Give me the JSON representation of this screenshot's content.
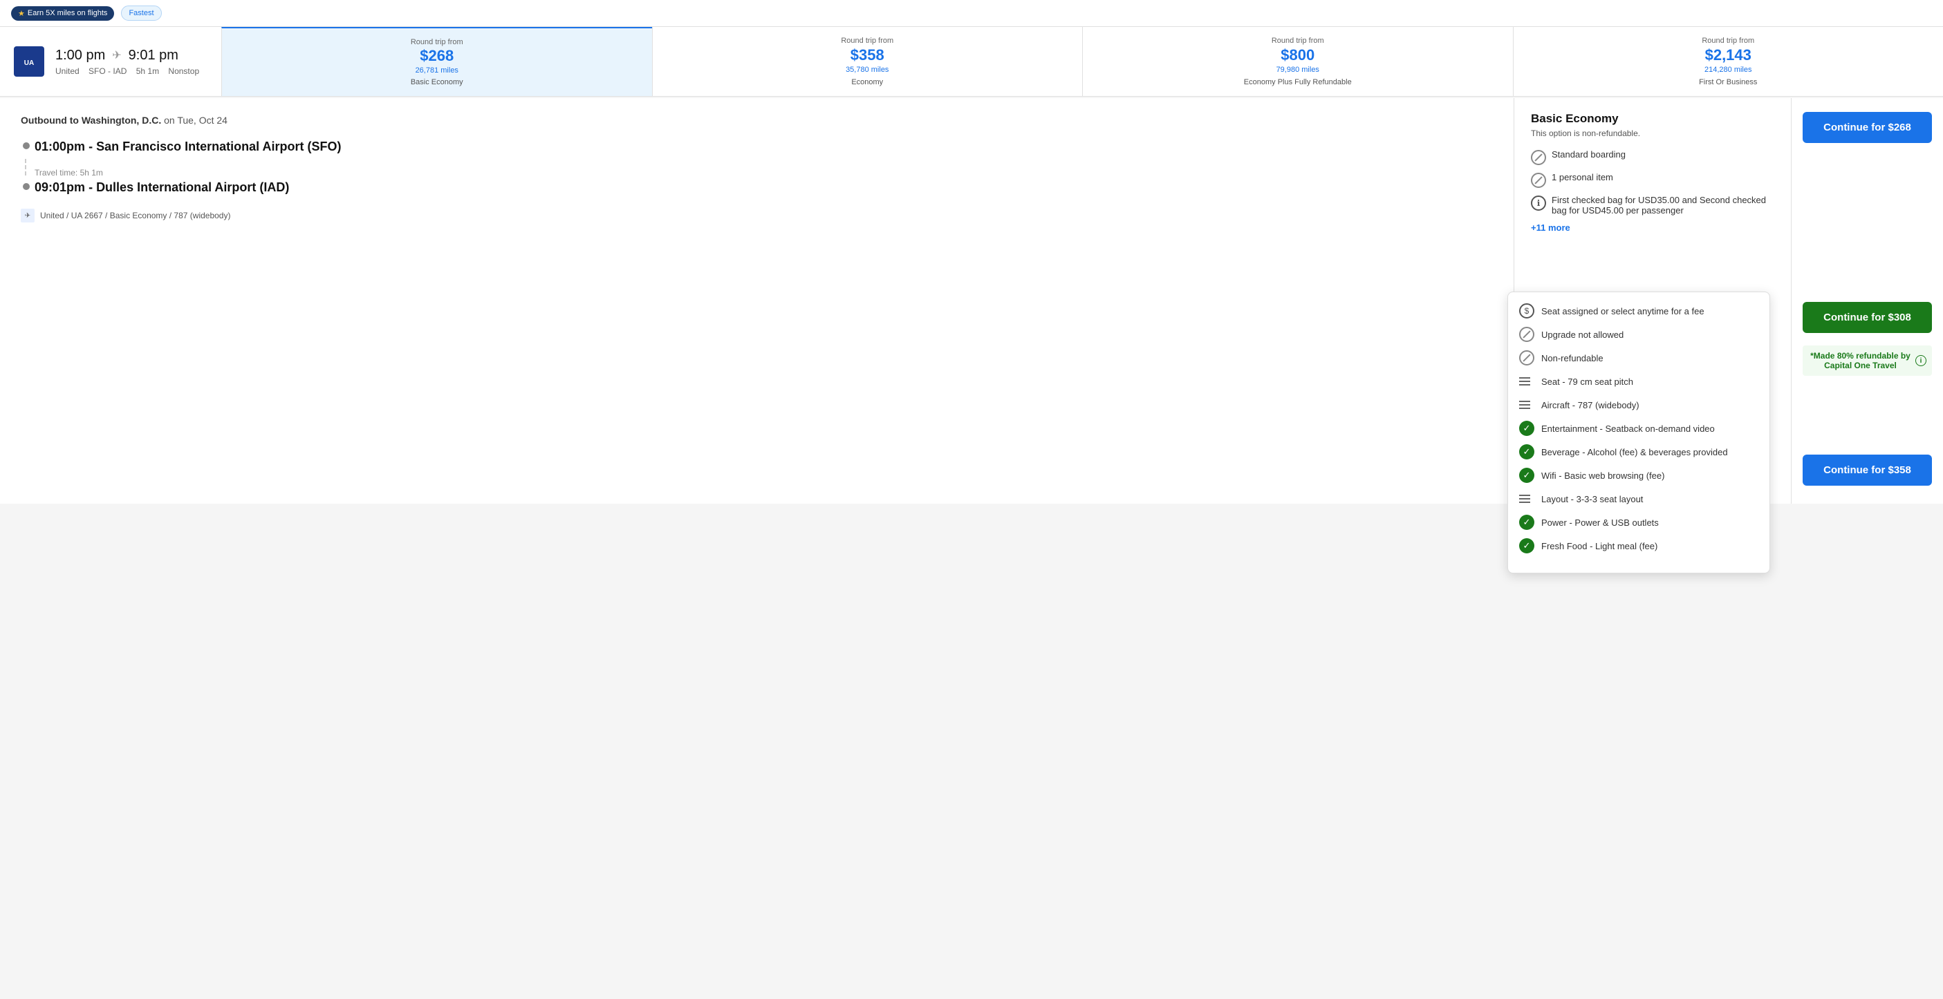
{
  "topBar": {
    "earnLabel": "Earn 5X miles on flights",
    "fastestLabel": "Fastest"
  },
  "flight": {
    "departTime": "1:00 pm",
    "arriveTime": "9:01 pm",
    "airline": "United",
    "route": "SFO - IAD",
    "duration": "5h 1m",
    "stops": "Nonstop"
  },
  "priceCards": [
    {
      "label": "Round trip from",
      "amount": "$268",
      "miles": "26,781 miles",
      "type": "Basic Economy",
      "selected": true
    },
    {
      "label": "Round trip from",
      "amount": "$358",
      "miles": "35,780 miles",
      "type": "Economy",
      "selected": false
    },
    {
      "label": "Round trip from",
      "amount": "$800",
      "miles": "79,980 miles",
      "type": "Economy Plus Fully Refundable",
      "selected": false
    },
    {
      "label": "Round trip from",
      "amount": "$2,143",
      "miles": "214,280 miles",
      "type": "First Or Business",
      "selected": false
    }
  ],
  "outbound": {
    "title": "Outbound to Washington, D.C.",
    "date": "on Tue, Oct 24",
    "departTime": "01:00pm",
    "departAirport": "San Francisco International Airport (SFO)",
    "travelTime": "Travel time: 5h 1m",
    "arriveTime": "09:01pm",
    "arriveAirport": "Dulles International Airport (IAD)",
    "flightDetail": "United / UA 2667 / Basic Economy / 787 (widebody)"
  },
  "farePanel": {
    "title": "Basic Economy",
    "subtitle": "This option is non-refundable.",
    "features": [
      {
        "icon": "block",
        "text": "Standard boarding"
      },
      {
        "icon": "block",
        "text": "1 personal item"
      },
      {
        "icon": "info",
        "text": "First checked bag for USD35.00 and Second checked bag for USD45.00 per passenger"
      }
    ],
    "moreLink": "+11 more",
    "continueBtn": "Continue for $268"
  },
  "dropdown": {
    "features": [
      {
        "icon": "dollar",
        "text": "Seat assigned or select anytime for a fee"
      },
      {
        "icon": "block",
        "text": "Upgrade not allowed"
      },
      {
        "icon": "block",
        "text": "Non-refundable"
      },
      {
        "icon": "lines",
        "text": "Seat - 79 cm seat pitch"
      },
      {
        "icon": "lines",
        "text": "Aircraft - 787 (widebody)"
      },
      {
        "icon": "check",
        "text": "Entertainment - Seatback on-demand video"
      },
      {
        "icon": "check",
        "text": "Beverage - Alcohol (fee) & beverages provided"
      },
      {
        "icon": "check",
        "text": "Wifi - Basic web browsing (fee)"
      },
      {
        "icon": "lines",
        "text": "Layout - 3-3-3 seat layout"
      },
      {
        "icon": "check",
        "text": "Power - Power & USB outlets"
      },
      {
        "icon": "check",
        "text": "Fresh Food - Light meal (fee)"
      }
    ]
  },
  "continueButtons": [
    {
      "label": "Continue for $268",
      "style": "blue"
    },
    {
      "label": "Continue for $308",
      "style": "green"
    },
    {
      "refundable": "*Made 80% refundable by Capital One Travel"
    },
    {
      "label": "Continue for $358",
      "style": "blue"
    }
  ]
}
